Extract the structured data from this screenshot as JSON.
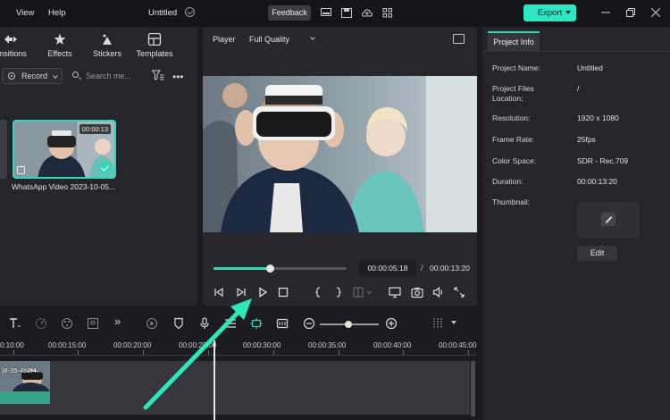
{
  "menu": {
    "view": "View",
    "help": "Help"
  },
  "window": {
    "title": "Untitled",
    "feedback": "Feedback",
    "export": "Export"
  },
  "library": {
    "tabs": [
      {
        "label": "ansitions",
        "icon": "transitions-icon"
      },
      {
        "label": "Effects",
        "icon": "effects-icon"
      },
      {
        "label": "Stickers",
        "icon": "stickers-icon"
      },
      {
        "label": "Templates",
        "icon": "templates-icon"
      }
    ],
    "record_label": "Record",
    "search_placeholder": "Search me...",
    "clip": {
      "duration": "00:00:13",
      "name": "WhatsApp Video 2023-10-05..."
    }
  },
  "player": {
    "label": "Player",
    "quality": "Full Quality",
    "current_time": "00:00:05:18",
    "separator": "/",
    "total_time": "00:00:13:20",
    "progress_fraction": 0.42
  },
  "project_info": {
    "tab": "Project Info",
    "rows": [
      {
        "key": "Project Name:",
        "value": "Untitled"
      },
      {
        "key": "Project Files Location:",
        "value": "/"
      },
      {
        "key": "Resolution:",
        "value": "1920 x 1080"
      },
      {
        "key": "Frame Rate:",
        "value": "25fps"
      },
      {
        "key": "Color Space:",
        "value": "SDR - Rec.709"
      },
      {
        "key": "Duration:",
        "value": "00:00:13:20"
      },
      {
        "key": "Thumbnail:",
        "value": ""
      }
    ],
    "edit_button": "Edit"
  },
  "timeline": {
    "ruler": [
      "0:10:00",
      "00:00:15:00",
      "00:00:20:00",
      "00:00:25:00",
      "00:00:30:00",
      "00:00:35:00",
      "00:00:40:00",
      "00:00:45:00"
    ],
    "clip_name": ")8-35-4b2f4..."
  },
  "colors": {
    "accent": "#35d5b9",
    "export": "#2ee6c4",
    "annotation_arrow": "#2ee6b6"
  }
}
